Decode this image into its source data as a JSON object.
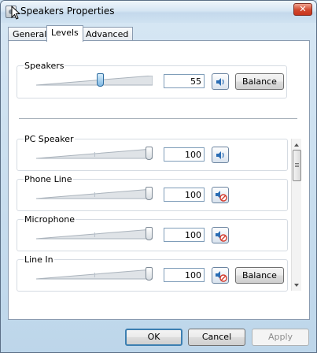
{
  "window": {
    "title": "Speakers Properties",
    "close_glyph": "✕"
  },
  "tabs": [
    {
      "label": "General",
      "active": false
    },
    {
      "label": "Levels",
      "active": true
    },
    {
      "label": "Advanced",
      "active": false
    }
  ],
  "master": {
    "label": "Speakers",
    "value": "55",
    "level": 0.55,
    "muted": false,
    "balance_label": "Balance"
  },
  "channels": [
    {
      "label": "PC Speaker",
      "value": "100",
      "level": 1.0,
      "muted": false,
      "has_balance": false
    },
    {
      "label": "Phone Line",
      "value": "100",
      "level": 1.0,
      "muted": true,
      "has_balance": false
    },
    {
      "label": "Microphone",
      "value": "100",
      "level": 1.0,
      "muted": true,
      "has_balance": false
    },
    {
      "label": "Line In",
      "value": "100",
      "level": 1.0,
      "muted": true,
      "has_balance": true,
      "balance_label": "Balance"
    }
  ],
  "buttons": {
    "ok": "OK",
    "cancel": "Cancel",
    "apply": "Apply"
  },
  "colors": {
    "accent": "#3c7fb1",
    "mute": "#d33a2c",
    "close": "#c9341c"
  }
}
